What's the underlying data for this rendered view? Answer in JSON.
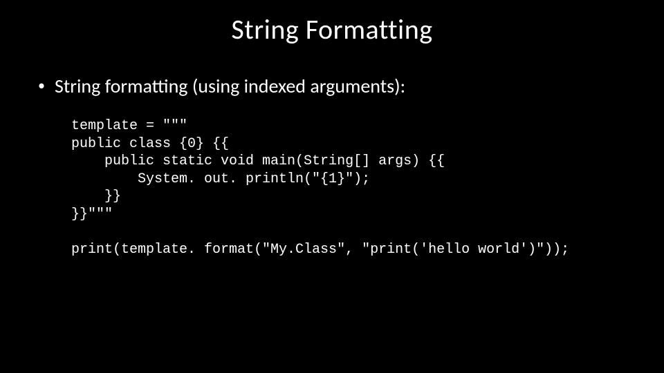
{
  "slide": {
    "title": "String Formatting",
    "bullet": "String formatting (using indexed arguments):",
    "code": "template = \"\"\"\npublic class {0} {{\n    public static void main(String[] args) {{\n        System. out. println(\"{1}\");\n    }}\n}}\"\"\"\n\nprint(template. format(\"My.Class\", \"print('hello world')\"));"
  }
}
